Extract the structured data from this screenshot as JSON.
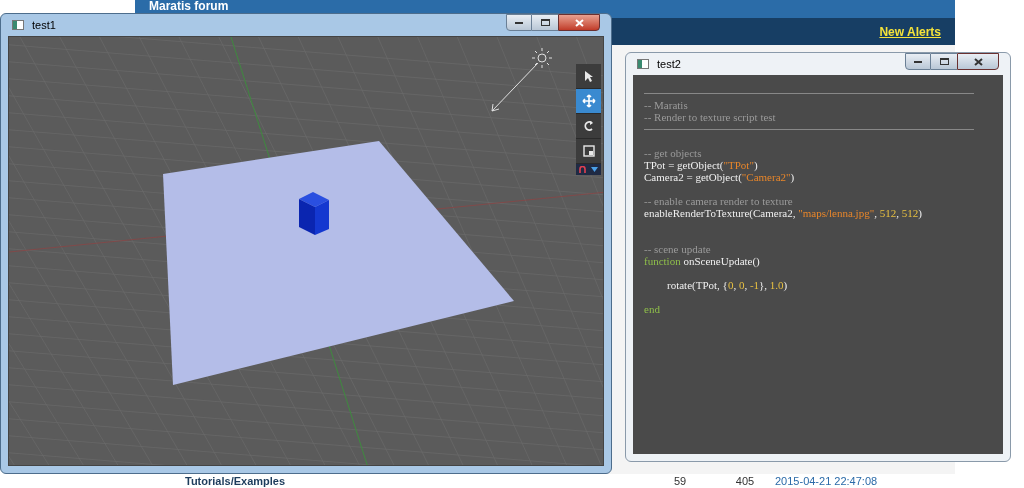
{
  "forum": {
    "title": "Maratis forum",
    "alerts_link": "New Alerts",
    "row": {
      "forum": "Tutorials/Examples",
      "topics": "59",
      "posts": "405",
      "last_post": "2015-04-21 22:47:08"
    }
  },
  "viewport_window": {
    "title": "test1",
    "active": true,
    "toolbar": [
      {
        "kind": "select",
        "selected": false
      },
      {
        "kind": "move",
        "selected": true
      },
      {
        "kind": "rotate",
        "selected": false
      },
      {
        "kind": "scale",
        "selected": false
      }
    ]
  },
  "script_window": {
    "title": "test2",
    "active": false,
    "lines": [
      {
        "kind": "rule"
      },
      {
        "kind": "code",
        "segments": [
          {
            "kind": "comment",
            "text": "-- Maratis"
          }
        ]
      },
      {
        "kind": "code",
        "segments": [
          {
            "kind": "comment",
            "text": "-- Render to texture script test"
          }
        ]
      },
      {
        "kind": "rule"
      },
      {
        "kind": "blank"
      },
      {
        "kind": "code",
        "segments": [
          {
            "kind": "comment",
            "text": "-- get objects"
          }
        ]
      },
      {
        "kind": "code",
        "segments": [
          {
            "kind": "plain",
            "text": "TPot = getObject("
          },
          {
            "kind": "string",
            "text": "\"TPot\""
          },
          {
            "kind": "plain",
            "text": ")"
          }
        ]
      },
      {
        "kind": "code",
        "segments": [
          {
            "kind": "plain",
            "text": "Camera2 = getObject("
          },
          {
            "kind": "string",
            "text": "\"Camera2\""
          },
          {
            "kind": "plain",
            "text": ")"
          }
        ]
      },
      {
        "kind": "blank"
      },
      {
        "kind": "code",
        "segments": [
          {
            "kind": "comment",
            "text": "-- enable camera render to texture"
          }
        ]
      },
      {
        "kind": "code",
        "segments": [
          {
            "kind": "plain",
            "text": "enableRenderToTexture(Camera2, "
          },
          {
            "kind": "string",
            "text": "\"maps/lenna.jpg\""
          },
          {
            "kind": "plain",
            "text": ", "
          },
          {
            "kind": "number",
            "text": "512"
          },
          {
            "kind": "plain",
            "text": ", "
          },
          {
            "kind": "number",
            "text": "512"
          },
          {
            "kind": "plain",
            "text": ")"
          }
        ]
      },
      {
        "kind": "blank"
      },
      {
        "kind": "blank"
      },
      {
        "kind": "code",
        "segments": [
          {
            "kind": "comment",
            "text": "-- scene update"
          }
        ]
      },
      {
        "kind": "code",
        "segments": [
          {
            "kind": "keyword",
            "text": "function"
          },
          {
            "kind": "plain",
            "text": " onSceneUpdate()"
          }
        ]
      },
      {
        "kind": "blank"
      },
      {
        "kind": "indent",
        "segments": [
          {
            "kind": "plain",
            "text": "rotate(TPot, {"
          },
          {
            "kind": "number",
            "text": "0"
          },
          {
            "kind": "plain",
            "text": ", "
          },
          {
            "kind": "number",
            "text": "0"
          },
          {
            "kind": "plain",
            "text": ", "
          },
          {
            "kind": "number",
            "text": "-1"
          },
          {
            "kind": "plain",
            "text": "}, "
          },
          {
            "kind": "number",
            "text": "1.0"
          },
          {
            "kind": "plain",
            "text": ")"
          }
        ]
      },
      {
        "kind": "blank"
      },
      {
        "kind": "code",
        "segments": [
          {
            "kind": "keyword",
            "text": "end"
          }
        ]
      }
    ]
  }
}
